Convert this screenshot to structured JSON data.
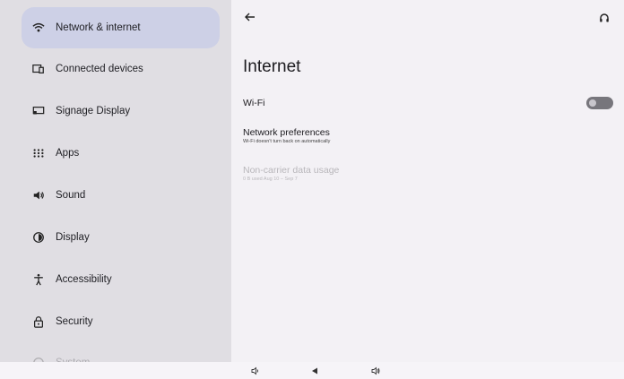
{
  "sidebar": {
    "items": [
      {
        "label": "Network & internet",
        "icon": "wifi-icon",
        "active": true
      },
      {
        "label": "Connected devices",
        "icon": "connected-devices-icon"
      },
      {
        "label": "Signage Display",
        "icon": "signage-display-icon"
      },
      {
        "label": "Apps",
        "icon": "apps-grid-icon"
      },
      {
        "label": "Sound",
        "icon": "volume-icon"
      },
      {
        "label": "Display",
        "icon": "brightness-icon"
      },
      {
        "label": "Accessibility",
        "icon": "accessibility-icon"
      },
      {
        "label": "Security",
        "icon": "lock-icon"
      },
      {
        "label": "System",
        "icon": "info-icon",
        "faded": true
      }
    ]
  },
  "header": {
    "back_icon": "back-arrow-icon",
    "help_icon": "help-headset-icon"
  },
  "page": {
    "title": "Internet",
    "wifi": {
      "label": "Wi-Fi",
      "enabled": false
    },
    "network_preferences": {
      "title": "Network preferences",
      "summary": "Wi-Fi doesn't turn back on automatically"
    },
    "non_carrier": {
      "title": "Non-carrier data usage",
      "summary": "0 B used Aug 10 – Sep 7"
    }
  },
  "colors": {
    "sidebar_bg": "#e0dee3",
    "active_item_bg": "#cdd0e6",
    "content_bg": "#f3f1f5",
    "toggle_off": "#77767c"
  }
}
